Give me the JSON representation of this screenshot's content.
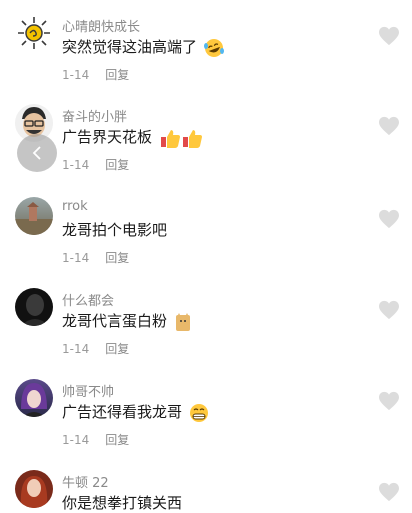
{
  "comments": [
    {
      "name": "心晴朗快成长",
      "text": "突然觉得这油高端了",
      "date": "1-14",
      "reply": "回复",
      "emoji": "laughing-tears-emoji",
      "avatar": "sun-avatar"
    },
    {
      "name": "奋斗的小胖",
      "text": "广告界天花板",
      "date": "1-14",
      "reply": "回复",
      "emoji": "thumbs-up-emoji",
      "avatar": "cartoon-man-avatar"
    },
    {
      "name": "rrok",
      "text": "龙哥拍个电影吧",
      "date": "1-14",
      "reply": "回复",
      "emoji": "",
      "avatar": "landscape-avatar"
    },
    {
      "name": "什么都会",
      "text": "龙哥代言蛋白粉",
      "date": "1-14",
      "reply": "回复",
      "emoji": "cat-emoji",
      "avatar": "dark-portrait-avatar"
    },
    {
      "name": "帅哥不帅",
      "text": "广告还得看我龙哥",
      "date": "1-14",
      "reply": "回复",
      "emoji": "grin-emoji",
      "avatar": "girl-portrait-avatar"
    },
    {
      "name": "牛顿 22",
      "text": "你是想拳打镇关西",
      "date": "",
      "reply": "",
      "emoji": "",
      "avatar": "redhair-avatar"
    }
  ],
  "colors": {
    "heart": "#dcdcdc",
    "name": "#8a8a8a",
    "text": "#1a1a1a"
  }
}
